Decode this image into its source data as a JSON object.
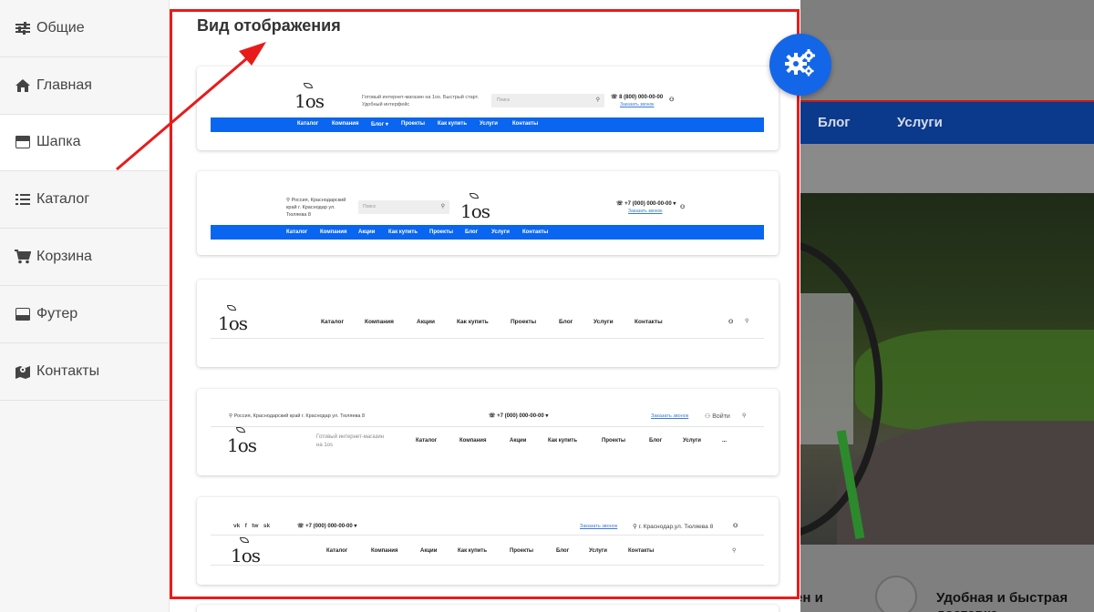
{
  "sidebar": {
    "items": [
      {
        "label": "Общие",
        "icon": "sliders-icon"
      },
      {
        "label": "Главная",
        "icon": "home-icon"
      },
      {
        "label": "Шапка",
        "icon": "header-icon"
      },
      {
        "label": "Каталог",
        "icon": "list-icon"
      },
      {
        "label": "Корзина",
        "icon": "cart-icon"
      },
      {
        "label": "Футер",
        "icon": "footer-icon"
      },
      {
        "label": "Контакты",
        "icon": "map-icon"
      }
    ],
    "active": "Шапка"
  },
  "panel": {
    "title": "Вид отображения"
  },
  "colors": {
    "accent": "#0a65f0",
    "highlight": "#e81b1b",
    "navy": "#0b3a8c"
  },
  "background_site": {
    "nav_items": [
      "Блог",
      "Услуги"
    ],
    "feature_left": "ен и",
    "feature_text": "Удобная и быстрая доставка"
  },
  "card1": {
    "logo": "1os",
    "tagline": "Готовый интернет-магазин на 1os. Быстрый старт. Удобный интерфейс",
    "search_placeholder": "Поиск",
    "phone": "8 (800) 000-00-00",
    "callback": "Заказать звонок",
    "menu": [
      "Каталог",
      "Компания",
      "Блог ▾",
      "Проекты",
      "Как купить",
      "Услуги",
      "Контакты"
    ]
  },
  "card2": {
    "address": "Россия, Краснодарский край г. Краснодар ул. Тюляева 8",
    "search_placeholder": "Поиск",
    "logo": "1os",
    "phone": "+7 (000) 000-00-00 ▾",
    "callback": "Заказать звонок",
    "menu": [
      "Каталог",
      "Компания",
      "Акции",
      "Как купить",
      "Проекты",
      "Блог",
      "Услуги",
      "Контакты"
    ]
  },
  "card3": {
    "logo": "1os",
    "menu": [
      "Каталог",
      "Компания",
      "Акции",
      "Как купить",
      "Проекты",
      "Блог",
      "Услуги",
      "Контакты"
    ]
  },
  "card4": {
    "address": "Россия, Краснодарский край г. Краснодар ул. Тюляева 8",
    "phone": "+7 (000) 000-00-00 ▾",
    "callback": "Заказать звонок",
    "login": "Войти",
    "logo": "1os",
    "tagline": "Готовый интернет-магазин на 1os",
    "menu": [
      "Каталог",
      "Компания",
      "Акции",
      "Как купить",
      "Проекты",
      "Блог",
      "Услуги",
      "..."
    ]
  },
  "card5": {
    "socials": [
      "vk",
      "f",
      "tw",
      "sk"
    ],
    "phone": "+7 (000) 000-00-00 ▾",
    "callback": "Заказать звонок",
    "address": "г. Краснодар,ул. Тюляева 8",
    "logo": "1os",
    "menu": [
      "Каталог",
      "Компания",
      "Акции",
      "Как купить",
      "Проекты",
      "Блог",
      "Услуги",
      "Контакты"
    ]
  }
}
